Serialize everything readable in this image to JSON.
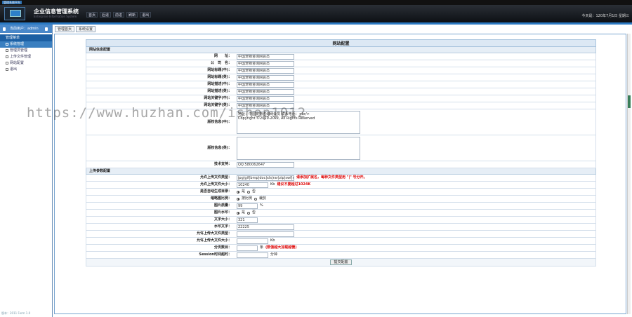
{
  "window": {
    "title": "管理系统平台"
  },
  "header": {
    "system_title": "企业信息管理系统",
    "system_subtitle": "Enterprise Information System",
    "nav": [
      "首页",
      "后退",
      "前进",
      "刷新",
      "退出"
    ],
    "today": "今天是：120年7月1日 星期三"
  },
  "sidebar": {
    "user": "当前用户：admin",
    "group": "管理菜单",
    "items": [
      "系统管理",
      "管理员管理",
      "上传文件管理",
      "网站配置",
      "退出"
    ],
    "version": "版本：2011 Form 1.0"
  },
  "tabs": [
    "管理首页",
    "系统设置"
  ],
  "form": {
    "title": "网站配置",
    "section1": "网站信息配置",
    "fields1": [
      {
        "label": "网　　址：",
        "value": "中国宠物咨询网会员"
      },
      {
        "label": "公　司　名：",
        "value": "中国宠物咨询网会员"
      },
      {
        "label": "网站标题(中)：",
        "value": "中国宠物咨询网会员"
      },
      {
        "label": "网站标题(英)：",
        "value": "中国宠物咨询网会员"
      },
      {
        "label": "网站描述(中)：",
        "value": "中国宠物咨询网会员"
      },
      {
        "label": "网站描述(英)：",
        "value": "中国宠物咨询网会员"
      },
      {
        "label": "网站关键字(中)：",
        "value": "中国宠物咨询网会员"
      },
      {
        "label": "网站关键字(英)：",
        "value": "中国宠物咨询网会员"
      }
    ],
    "copyright_cn_label": "版权信息(中)：",
    "copyright_cn_value": "地址：中国宠物咨询网会员  联系电话：<br/>\nCopyright ©2010-20xx, All Rights Reserved",
    "copyright_en_label": "版权信息(英)：",
    "copyright_en_value": "",
    "support_label": "技术支持：",
    "support_value": "QQ:580062647",
    "section2": "上传参数配置",
    "ext_label": "允许上传文件类型：",
    "ext_value": "jpg|gif|bmp|doc|xls|rar|zip|swf|mp3|wma|wmv",
    "ext_note": "请添加扩展名，每种文件类型用 \"|\" 号分开。",
    "size_label": "允许上传文件大小：",
    "size_value": "10240",
    "size_unit": "Kb",
    "size_note": "建议不要超过1024K",
    "dir_label": "是否自动生成目录：",
    "dir_opts": [
      "是",
      "否"
    ],
    "dir_sel": 0,
    "thumb_label": "缩略图比例：",
    "thumb_opts": [
      "按比例",
      "裁剪"
    ],
    "thumb_sel": 0,
    "quality_label": "图片质量：",
    "quality_value": "99",
    "quality_unit": "%",
    "wm_label": "图片水印：",
    "wm_opts": [
      "是",
      "否"
    ],
    "wm_sel": 0,
    "fontsize_label": "文字大小：",
    "fontsize_value": "321",
    "wmtext_label": "水印文字：",
    "wmtext_value": "22225",
    "bigtype_label": "允许上传大文件类型：",
    "bigtype_value": "",
    "bigsize_label": "允许上传大文件大小：",
    "bigsize_value": "",
    "bigsize_unit": "Kb",
    "pagesize_label": "分页数目：",
    "pagesize_value": "",
    "pagesize_unit": "条",
    "pagesize_note": "(数值越大加载越慢)",
    "session_label": "Session时间超时：",
    "session_value": "",
    "session_unit": "分钟",
    "submit": "提交配置"
  },
  "watermark": "https://www.huzhan.com/ishop1012"
}
